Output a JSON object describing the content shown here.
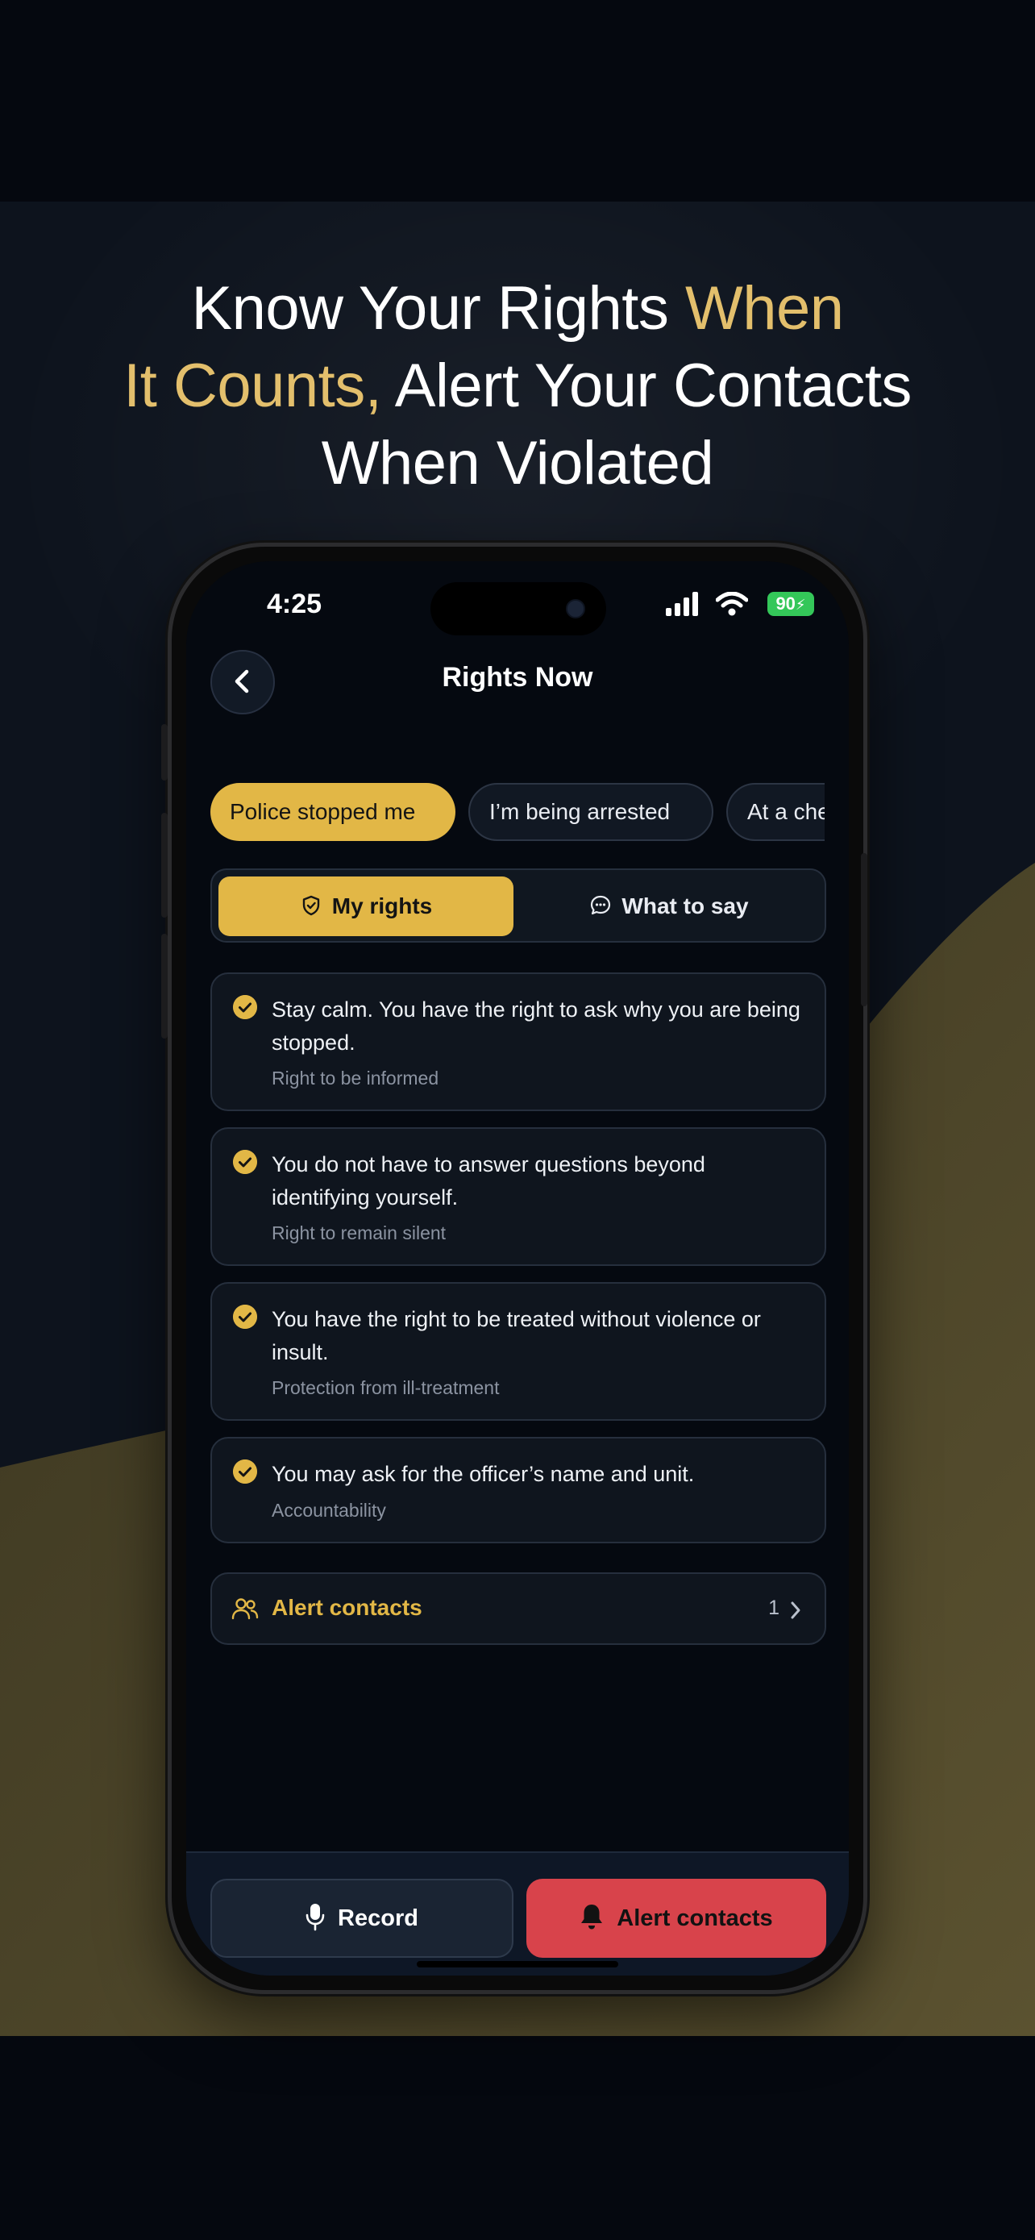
{
  "headline": {
    "line1_white": "Know Your Rights ",
    "line1_gold": "When",
    "line2_gold": "It Counts,",
    "line2_white": " Alert Your Contacts",
    "line3_white": "When Violated"
  },
  "status_bar": {
    "time": "4:25",
    "battery": "90"
  },
  "nav": {
    "title": "Rights Now",
    "back_icon": "chevron-left-icon"
  },
  "scenarios": [
    {
      "label": "Police stopped me",
      "active": true
    },
    {
      "label": "I’m being arrested",
      "active": false
    },
    {
      "label": "At a che",
      "active": false
    }
  ],
  "segments": {
    "my_rights": "My rights",
    "what_to_say": "What to say",
    "selected": "my_rights"
  },
  "rights": [
    {
      "text": "Stay calm. You have the right to ask why you are being stopped.",
      "category": "Right to be informed"
    },
    {
      "text": "You do not have to answer questions beyond identifying yourself.",
      "category": "Right to remain silent"
    },
    {
      "text": "You have the right to be treated without violence or insult.",
      "category": "Protection from ill-treatment"
    },
    {
      "text": "You may ask for the officer’s name and unit.",
      "category": "Accountability"
    }
  ],
  "alert_row": {
    "label": "Alert contacts",
    "count": "1"
  },
  "actions": {
    "record": "Record",
    "alert": "Alert contacts"
  },
  "colors": {
    "accent": "#e2b746",
    "danger": "#d8434b",
    "headline_gold": "#e3bf6c",
    "background": "#05080f"
  }
}
